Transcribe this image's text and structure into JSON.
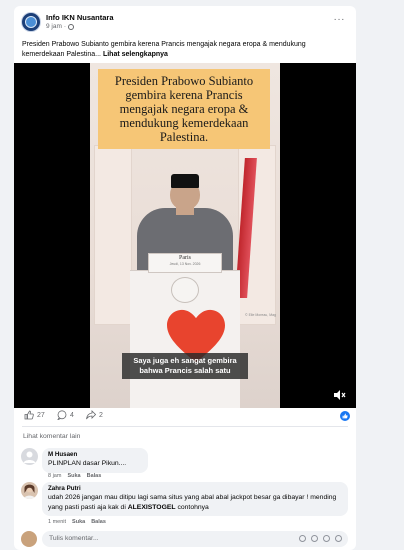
{
  "post": {
    "page_name": "Info IKN Nusantara",
    "time": "9 jam",
    "caption": "Presiden Prabowo Subianto gembira kerena Prancis mengajak negara eropa & mendukung kemerdekaan Palestina...",
    "see_more": "Lihat selengkapnya",
    "more_icon": "···"
  },
  "video": {
    "headline": "Presiden Prabowo Subianto gembira kerena Prancis mengajak negara eropa & mendukung kemerdekaan Palestina.",
    "podium_city": "Paris",
    "podium_date": "Jeudi, 13 Nov. 2026",
    "watermark": "© Elle Moreau, Mag",
    "subtitle": "Saya juga eh sangat gembira bahwa Prancis salah satu",
    "heart_color": "#e8442e",
    "mute_icon": "speaker-mute-icon"
  },
  "reactions": {
    "likes": "27",
    "comments": "4",
    "shares": "2",
    "accent": "#1877f2"
  },
  "comments_section": {
    "view_more": "Lihat komentar lain",
    "items": [
      {
        "name": "M Husaen",
        "text": "PLINPLAN dasar Pikun....",
        "time": "8 jam",
        "like": "Suka",
        "reply": "Balas"
      },
      {
        "name": "Zahra Putri",
        "text_before": "udah 2026 jangan mau ditipu lagi sama situs yang abal abal jackpot besar ga dibayar ! mending yang pasti pasti aja kak di ",
        "text_bold": "ALEXISTOGEL",
        "text_after": " contohnya",
        "time": "1 menit",
        "like": "Suka",
        "reply": "Balas"
      }
    ],
    "write_placeholder": "Tulis komentar..."
  }
}
